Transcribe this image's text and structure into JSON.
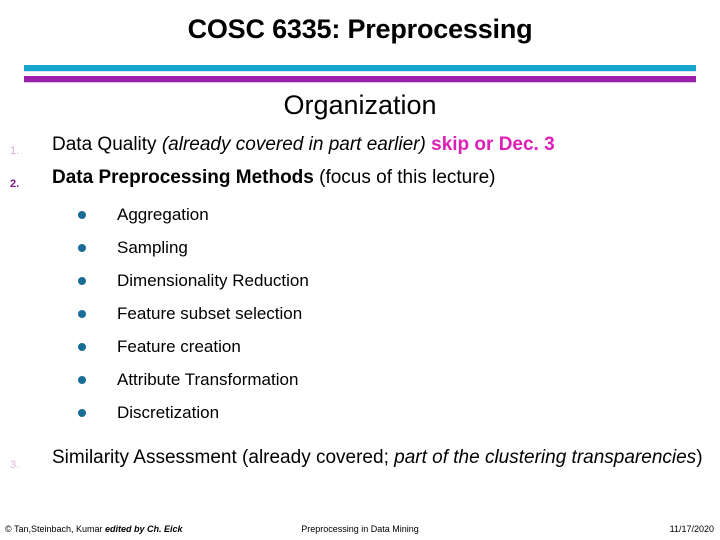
{
  "slide": {
    "title": "COSC 6335: Preprocessing",
    "section_heading": "Organization",
    "accent_colors": {
      "divider_top": "#17A5CE",
      "divider_bottom": "#9B1FA8",
      "accent_text": "#DD1FB8",
      "sub_bullet": "#1A6E96",
      "number_light": "#D9A8D4",
      "number_dark": "#7D1A86"
    },
    "items": [
      {
        "number": "1.",
        "number_style": "light",
        "parts": [
          {
            "text": "Data Quality ",
            "style": "normal"
          },
          {
            "text": "(already covered in part earlier)",
            "style": "italic"
          },
          {
            "text": " ",
            "style": "normal"
          },
          {
            "text": "skip or Dec. 3",
            "style": "accent"
          }
        ]
      },
      {
        "number": "2.",
        "number_style": "dark",
        "parts": [
          {
            "text": "Data Preprocessing Methods",
            "style": "bold"
          },
          {
            "text": " (focus of this lecture)",
            "style": "normal"
          }
        ],
        "sub_items": [
          "Aggregation",
          "Sampling",
          "Dimensionality Reduction",
          "Feature subset selection",
          "Feature creation",
          "Attribute Transformation",
          "Discretization"
        ]
      },
      {
        "number": "3.",
        "number_style": "faint",
        "parts": [
          {
            "text": "Similarity Assessment (already covered; ",
            "style": "normal"
          },
          {
            "text": "part of the clustering transparencies",
            "style": "italic"
          },
          {
            "text": ")",
            "style": "normal"
          }
        ]
      }
    ]
  },
  "footer": {
    "left_plain": "© Tan,Steinbach, Kumar",
    "left_italic": "edited by Ch. Eick",
    "center": "Preprocessing in Data Mining",
    "right": "11/17/2020"
  }
}
